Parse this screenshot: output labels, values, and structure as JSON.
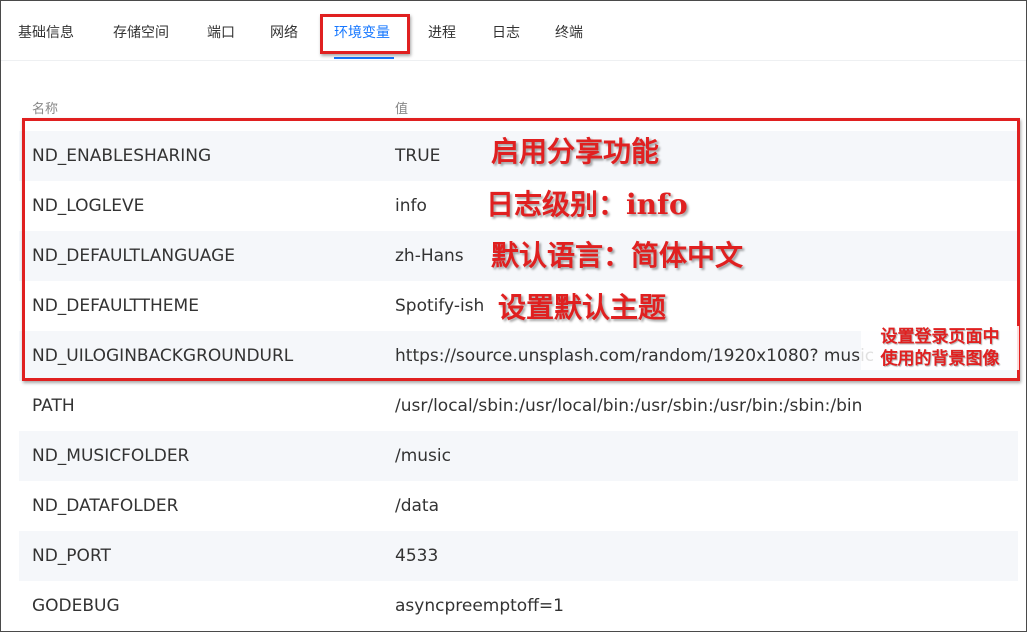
{
  "tabs": [
    "基础信息",
    "存储空间",
    "端口",
    "网络",
    "环境变量",
    "进程",
    "日志",
    "终端"
  ],
  "active_tab": "环境变量",
  "table": {
    "headers": {
      "name": "名称",
      "value": "值"
    },
    "rows": [
      {
        "name": "ND_ENABLESHARING",
        "value": "TRUE"
      },
      {
        "name": "ND_LOGLEVE",
        "value": "info"
      },
      {
        "name": "ND_DEFAULTLANGUAGE",
        "value": "zh-Hans"
      },
      {
        "name": "ND_DEFAULTTHEME",
        "value": "Spotify-ish"
      },
      {
        "name": "ND_UILOGINBACKGROUNDURL",
        "value": "https://source.unsplash.com/random/1920x1080?  music"
      },
      {
        "name": "PATH",
        "value": "/usr/local/sbin:/usr/local/bin:/usr/sbin:/usr/bin:/sbin:/bin"
      },
      {
        "name": "ND_MUSICFOLDER",
        "value": "/music"
      },
      {
        "name": "ND_DATAFOLDER",
        "value": "/data"
      },
      {
        "name": "ND_PORT",
        "value": "4533"
      },
      {
        "name": "GODEBUG",
        "value": "asyncpreemptoff=1"
      }
    ]
  },
  "annotations": {
    "enable_sharing": "启用分享功能",
    "log_level": "日志级别：info",
    "default_language": "默认语言：简体中文",
    "default_theme": "设置默认主题",
    "login_bg_line1": "设置登录页面中",
    "login_bg_line2": "使用的背景图像"
  },
  "colors": {
    "accent": "#1677ff",
    "annotation": "#e02020",
    "row_alt": "#f5f7fa"
  }
}
